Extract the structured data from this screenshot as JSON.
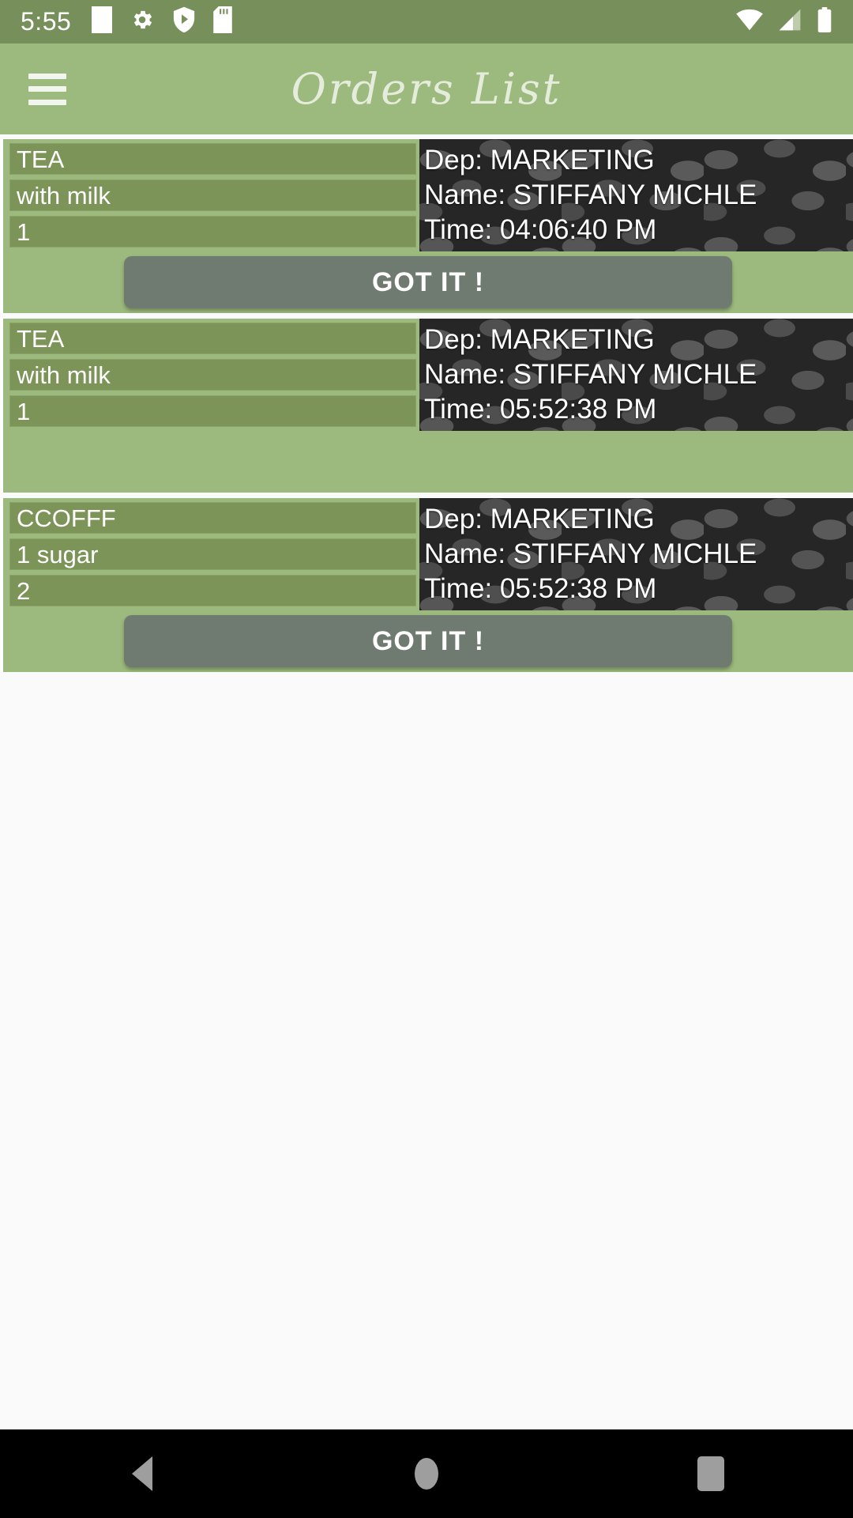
{
  "status_bar": {
    "time": "5:55",
    "left_icons": [
      "white-square-icon",
      "gear-icon",
      "shield-play-icon",
      "sd-card-icon"
    ],
    "right_icons": [
      "wifi-icon",
      "cellular-signal-icon",
      "battery-icon"
    ],
    "background_color": "#77905b"
  },
  "app_bar": {
    "title": "Orders List",
    "menu_icon": "hamburger-menu-icon",
    "background_color": "#9cba7d",
    "title_color": "#e5ecdb"
  },
  "colors": {
    "accent_green": "#9cba7d",
    "field_green": "#7d9459",
    "dark_panel": "#262626",
    "button_gray": "#6f7a70",
    "page_background": "#fafafa"
  },
  "orders": [
    {
      "item": "TEA",
      "note": "with milk",
      "quantity": "1",
      "dep_line": "Dep: MARKETING",
      "name_line": "Name: STIFFANY MICHLE",
      "time_line": "Time: 04:06:40 PM",
      "action_label": "GOT IT !",
      "has_action": true
    },
    {
      "item": "TEA",
      "note": "with milk",
      "quantity": "1",
      "dep_line": "Dep: MARKETING",
      "name_line": "Name: STIFFANY MICHLE",
      "time_line": "Time: 05:52:38 PM",
      "action_label": "",
      "has_action": false
    },
    {
      "item": "CCOFFF",
      "note": "1  sugar",
      "quantity": "2",
      "dep_line": "Dep: MARKETING",
      "name_line": "Name: STIFFANY MICHLE",
      "time_line": "Time: 05:52:38 PM",
      "action_label": "GOT IT !",
      "has_action": true
    }
  ],
  "nav_bar": {
    "back": "back-triangle-icon",
    "home": "home-circle-icon",
    "recents": "recents-square-icon",
    "background_color": "#000000"
  }
}
